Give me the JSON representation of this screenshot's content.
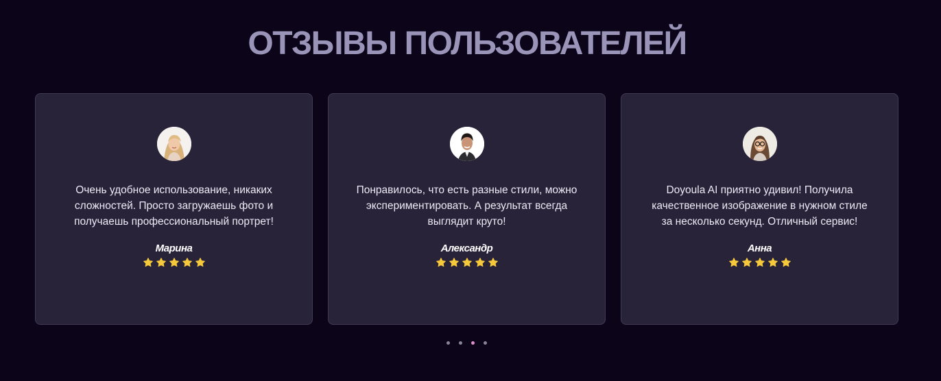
{
  "section": {
    "title": "ОТЗЫВЫ ПОЛЬЗОВАТЕЛЕЙ"
  },
  "reviews": [
    {
      "text": "Очень удобное использование, никаких сложностей. Просто загружаешь фото и получаешь профессиональный портрет!",
      "name": "Марина",
      "rating": 5,
      "avatar": "avatar-woman-blonde-icon"
    },
    {
      "text": "Понравилось, что есть разные стили, можно экспериментировать. А результат всегда выглядит круто!",
      "name": "Александр",
      "rating": 5,
      "avatar": "avatar-man-dark-hair-icon"
    },
    {
      "text": "Doyoula AI приятно удивил! Получила качественное изображение в нужном стиле за несколько секунд. Отличный сервис!",
      "name": "Анна",
      "rating": 5,
      "avatar": "avatar-woman-glasses-icon"
    }
  ],
  "pagination": {
    "total": 4,
    "active_index": 2
  },
  "colors": {
    "background": "#0c0418",
    "card": "#29233a",
    "title": "#9a94b8",
    "star": "#f5c93b",
    "active_dot": "#e38fd0"
  }
}
